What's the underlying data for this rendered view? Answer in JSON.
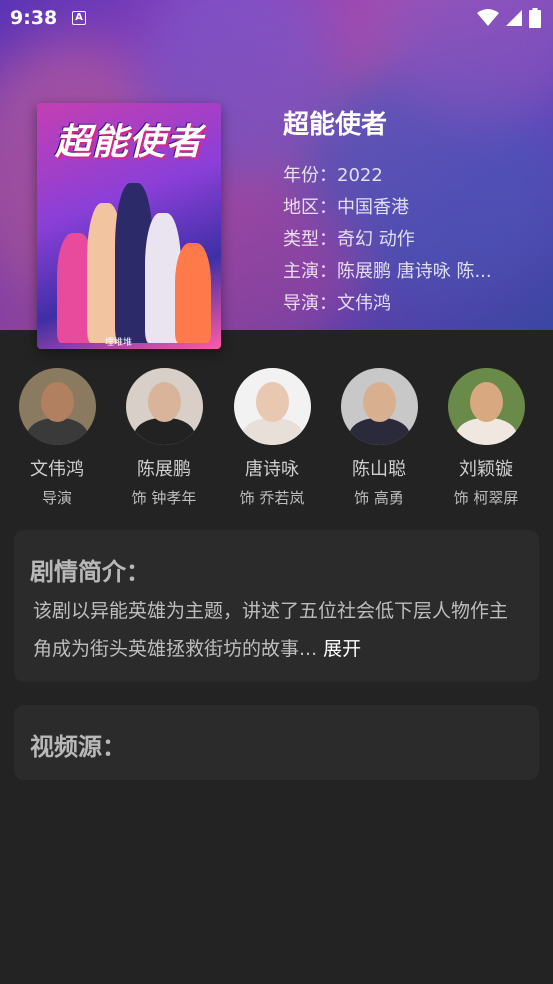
{
  "status_bar": {
    "time": "9:38",
    "sim_badge": "A"
  },
  "movie": {
    "poster_title": "超能使者",
    "poster_logo": "埋堆堆",
    "title": "超能使者",
    "info": [
      {
        "label": "年份：",
        "value": "2022"
      },
      {
        "label": "地区：",
        "value": "中国香港"
      },
      {
        "label": "类型：",
        "value": "奇幻 动作"
      },
      {
        "label": "主演：",
        "value": "陈展鹏 唐诗咏 陈..."
      },
      {
        "label": "导演：",
        "value": "文伟鸿"
      }
    ]
  },
  "cast": [
    {
      "name": "文伟鸿",
      "role": "导演"
    },
    {
      "name": "陈展鹏",
      "role": "饰 钟孝年"
    },
    {
      "name": "唐诗咏",
      "role": "饰 乔若岚"
    },
    {
      "name": "陈山聪",
      "role": "饰 高勇"
    },
    {
      "name": "刘颖镟",
      "role": "饰 柯翠屏"
    }
  ],
  "synopsis": {
    "heading": "剧情简介：",
    "text": "该剧以异能英雄为主题，讲述了五位社会低下层人物作主角成为街头英雄拯救街坊的故事...",
    "expand_label": "展开"
  },
  "sources": {
    "heading": "视频源："
  },
  "colors": {
    "background": "#232323",
    "card": "#2b2b2b",
    "hero_accent": "#a84fe0"
  }
}
